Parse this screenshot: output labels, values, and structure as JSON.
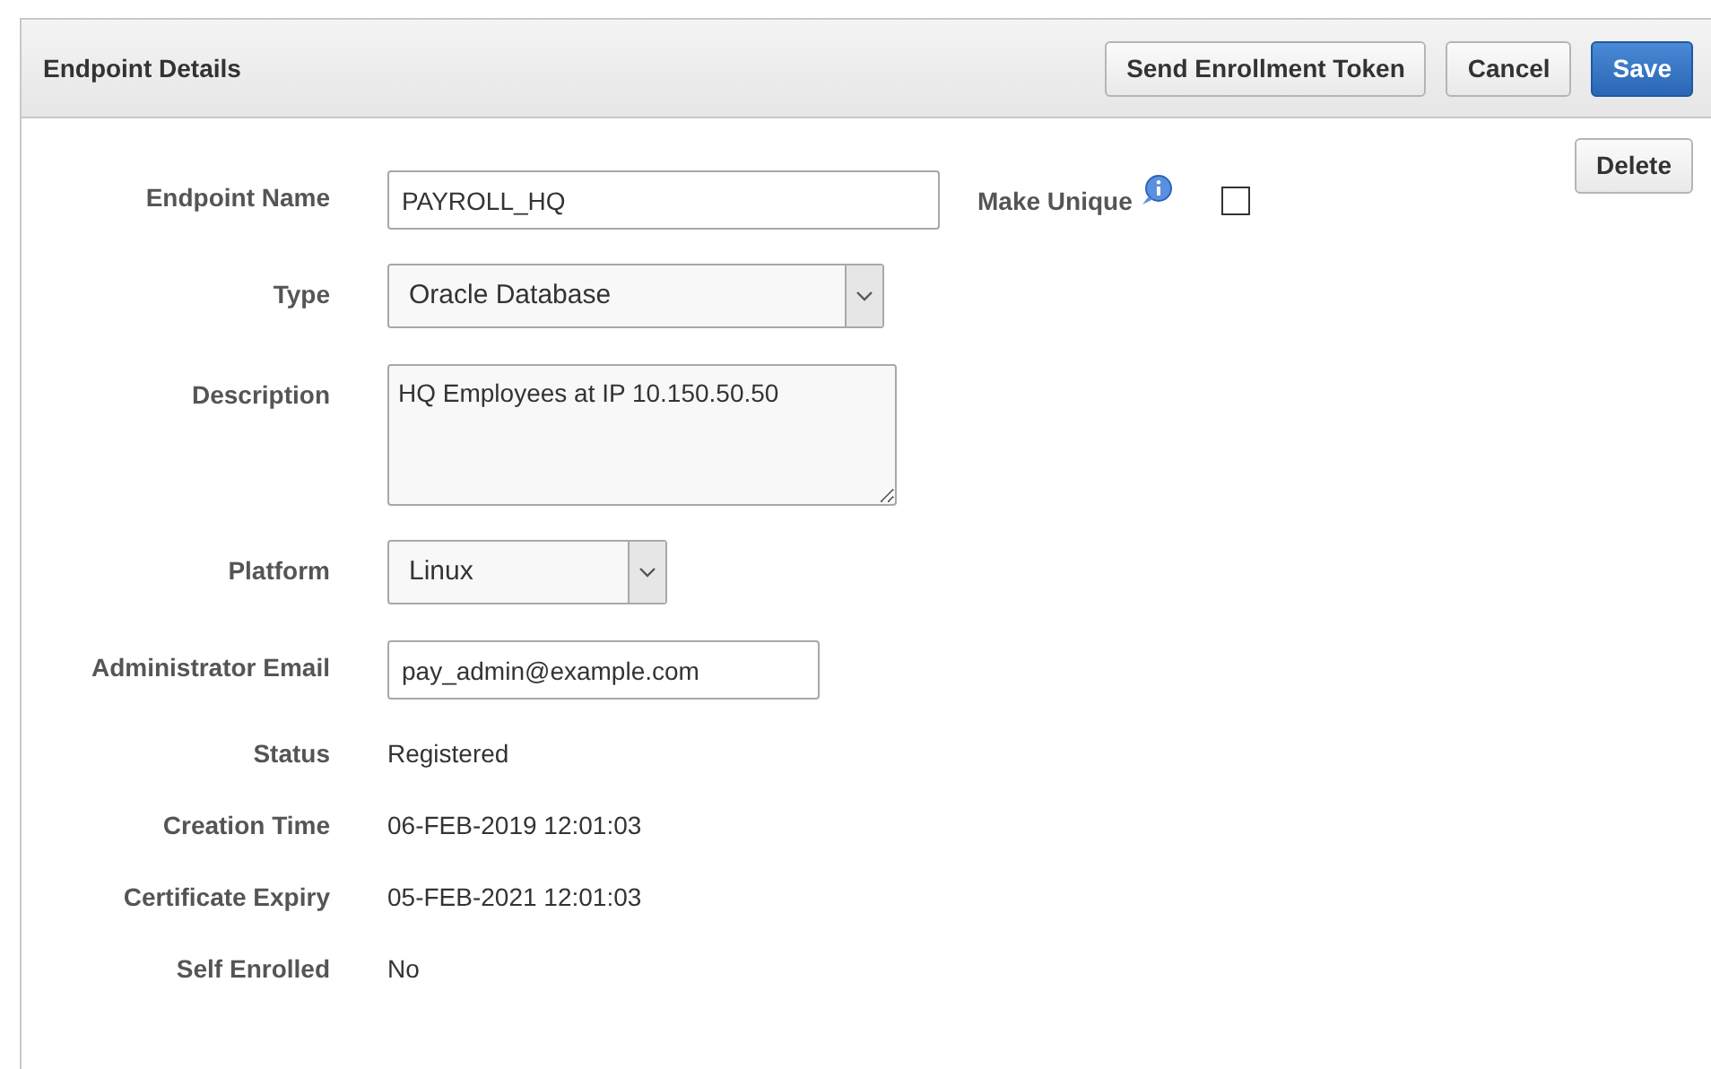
{
  "panel": {
    "title": "Endpoint Details",
    "buttons": [
      {
        "label": "Send Enrollment Token",
        "kind": "default"
      },
      {
        "label": "Cancel",
        "kind": "default"
      },
      {
        "label": "Save",
        "kind": "primary"
      }
    ],
    "delete_button": "Delete"
  },
  "fields": [
    {
      "label": "Endpoint Name",
      "kind": "text",
      "value": "PAYROLL_HQ",
      "extra": {
        "label": "Make Unique",
        "checked": false
      }
    },
    {
      "label": "Type",
      "kind": "select",
      "value": "Oracle Database"
    },
    {
      "label": "Description",
      "kind": "textarea",
      "value": "HQ Employees at IP 10.150.50.50"
    },
    {
      "label": "Platform",
      "kind": "select",
      "value": "Linux"
    },
    {
      "label": "Administrator Email",
      "kind": "text",
      "value": "pay_admin@example.com"
    },
    {
      "label": "Status",
      "kind": "static",
      "value": "Registered"
    },
    {
      "label": "Creation Time",
      "kind": "static",
      "value": "06-FEB-2019 12:01:03"
    },
    {
      "label": "Certificate Expiry",
      "kind": "static",
      "value": "05-FEB-2021 12:01:03"
    },
    {
      "label": "Self Enrolled",
      "kind": "static",
      "value": "No"
    }
  ]
}
